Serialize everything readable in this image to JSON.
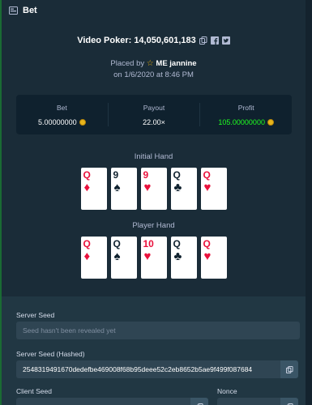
{
  "header": {
    "title": "Bet"
  },
  "game": {
    "title": "Video Poker: 14,050,601,183"
  },
  "placed": {
    "prefix": "Placed by",
    "user": "ME jannine",
    "date": "on 1/6/2020 at 8:46 PM"
  },
  "stats": {
    "bet": {
      "label": "Bet",
      "value": "5.00000000"
    },
    "payout": {
      "label": "Payout",
      "value": "22.00×"
    },
    "profit": {
      "label": "Profit",
      "value": "105.00000000"
    }
  },
  "initial_hand": {
    "label": "Initial Hand",
    "cards": [
      {
        "rank": "Q",
        "suit": "♦",
        "color": "red"
      },
      {
        "rank": "9",
        "suit": "♠",
        "color": "black"
      },
      {
        "rank": "9",
        "suit": "♥",
        "color": "red"
      },
      {
        "rank": "Q",
        "suit": "♣",
        "color": "black"
      },
      {
        "rank": "Q",
        "suit": "♥",
        "color": "red"
      }
    ]
  },
  "player_hand": {
    "label": "Player Hand",
    "cards": [
      {
        "rank": "Q",
        "suit": "♦",
        "color": "red"
      },
      {
        "rank": "Q",
        "suit": "♠",
        "color": "black"
      },
      {
        "rank": "10",
        "suit": "♥",
        "color": "red"
      },
      {
        "rank": "Q",
        "suit": "♣",
        "color": "black"
      },
      {
        "rank": "Q",
        "suit": "♥",
        "color": "red"
      }
    ]
  },
  "seeds": {
    "server_seed_label": "Server Seed",
    "server_seed_placeholder": "Seed hasn't been revealed yet",
    "server_seed_hashed_label": "Server Seed (Hashed)",
    "server_seed_hashed_value": "2548319491670dedefbe469008f68b95deee52c2eb8652b5ae9f499f087684",
    "client_seed_label": "Client Seed",
    "nonce_label": "Nonce"
  },
  "colors": {
    "profit": "#1fff20",
    "card_red": "#e9113c",
    "accent_star": "#e1a70b"
  },
  "icons": [
    "bet-icon",
    "copy-icon",
    "facebook-icon",
    "twitter-icon",
    "star-icon",
    "coin-icon"
  ]
}
